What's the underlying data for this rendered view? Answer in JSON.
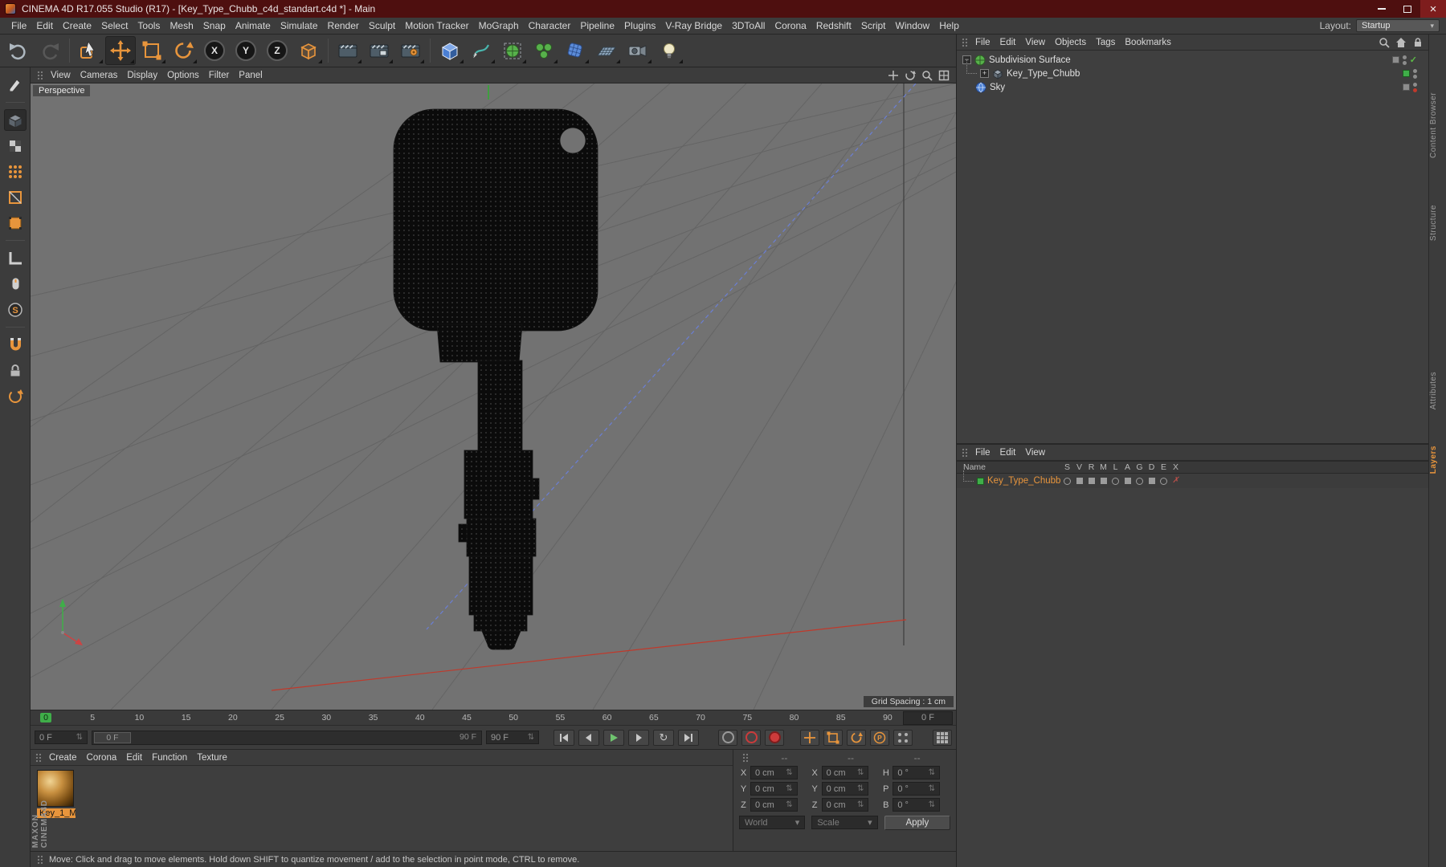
{
  "colors": {
    "accent_orange": "#e8953c",
    "marker_green": "#3fae49",
    "titlebar_red": "#4e0f0f"
  },
  "title_bar": {
    "title": "CINEMA 4D R17.055 Studio (R17) - [Key_Type_Chubb_c4d_standart.c4d *] - Main"
  },
  "menu_bar": {
    "items": [
      "File",
      "Edit",
      "Create",
      "Select",
      "Tools",
      "Mesh",
      "Snap",
      "Animate",
      "Simulate",
      "Render",
      "Sculpt",
      "Motion Tracker",
      "MoGraph",
      "Character",
      "Pipeline",
      "Plugins",
      "V-Ray Bridge",
      "3DToAll",
      "Corona",
      "Redshift",
      "Script",
      "Window",
      "Help"
    ],
    "layout_label": "Layout:",
    "layout_value": "Startup"
  },
  "toolbar": {
    "axis_labels": [
      "X",
      "Y",
      "Z"
    ]
  },
  "viewport": {
    "menu": [
      "View",
      "Cameras",
      "Display",
      "Options",
      "Filter",
      "Panel"
    ],
    "view_label": "Perspective",
    "grid_spacing": "Grid Spacing : 1 cm"
  },
  "object_manager": {
    "menu": [
      "File",
      "Edit",
      "View",
      "Objects",
      "Tags",
      "Bookmarks"
    ],
    "items": [
      {
        "name": "Subdivision Surface"
      },
      {
        "name": "Key_Type_Chubb"
      },
      {
        "name": "Sky"
      }
    ]
  },
  "layer_manager": {
    "menu": [
      "File",
      "Edit",
      "View"
    ],
    "name_header": "Name",
    "columns": [
      "S",
      "V",
      "R",
      "M",
      "L",
      "A",
      "G",
      "D",
      "E",
      "X"
    ],
    "rows": [
      {
        "name": "Key_Type_Chubb"
      }
    ]
  },
  "side_tabs": {
    "tabs": [
      "Content Browser",
      "Structure",
      "Attributes",
      "Layers"
    ],
    "active": "Layers"
  },
  "timeline": {
    "ticks": [
      "0",
      "5",
      "10",
      "15",
      "20",
      "25",
      "30",
      "35",
      "40",
      "45",
      "50",
      "55",
      "60",
      "65",
      "70",
      "75",
      "80",
      "85",
      "90"
    ],
    "current_frame": "0 F"
  },
  "transport": {
    "start_frame": "0 F",
    "slider_handle": "0 F",
    "slider_end": "90 F",
    "end_frame": "90 F"
  },
  "material_manager": {
    "menu": [
      "Create",
      "Corona",
      "Edit",
      "Function",
      "Texture"
    ],
    "materials": [
      {
        "name": "Key_1_M"
      }
    ],
    "brand_line1": "MAXON",
    "brand_line2": "CINEMA4D"
  },
  "coordinates": {
    "headers": [
      "--",
      "--",
      "--"
    ],
    "rows": [
      {
        "l1": "X",
        "v1": "0 cm",
        "l2": "X",
        "v2": "0 cm",
        "l3": "H",
        "v3": "0 °"
      },
      {
        "l1": "Y",
        "v1": "0 cm",
        "l2": "Y",
        "v2": "0 cm",
        "l3": "P",
        "v3": "0 °"
      },
      {
        "l1": "Z",
        "v1": "0 cm",
        "l2": "Z",
        "v2": "0 cm",
        "l3": "B",
        "v3": "0 °"
      }
    ],
    "space_dropdown": "World",
    "mode_dropdown": "Scale",
    "apply_label": "Apply"
  },
  "status_bar": {
    "text": "Move: Click and drag to move elements. Hold down SHIFT to quantize movement / add to the selection in point mode, CTRL to remove."
  },
  "icons": {
    "dropdown_arrow": "▾",
    "stepper": "⇅",
    "check_mark": "✓",
    "window_close": "×",
    "loop_glyph": "↻",
    "minus_glyph": "−",
    "plus_glyph": "+",
    "x_mark": "✗",
    "snap_letter": "S",
    "param_letter": "P"
  }
}
